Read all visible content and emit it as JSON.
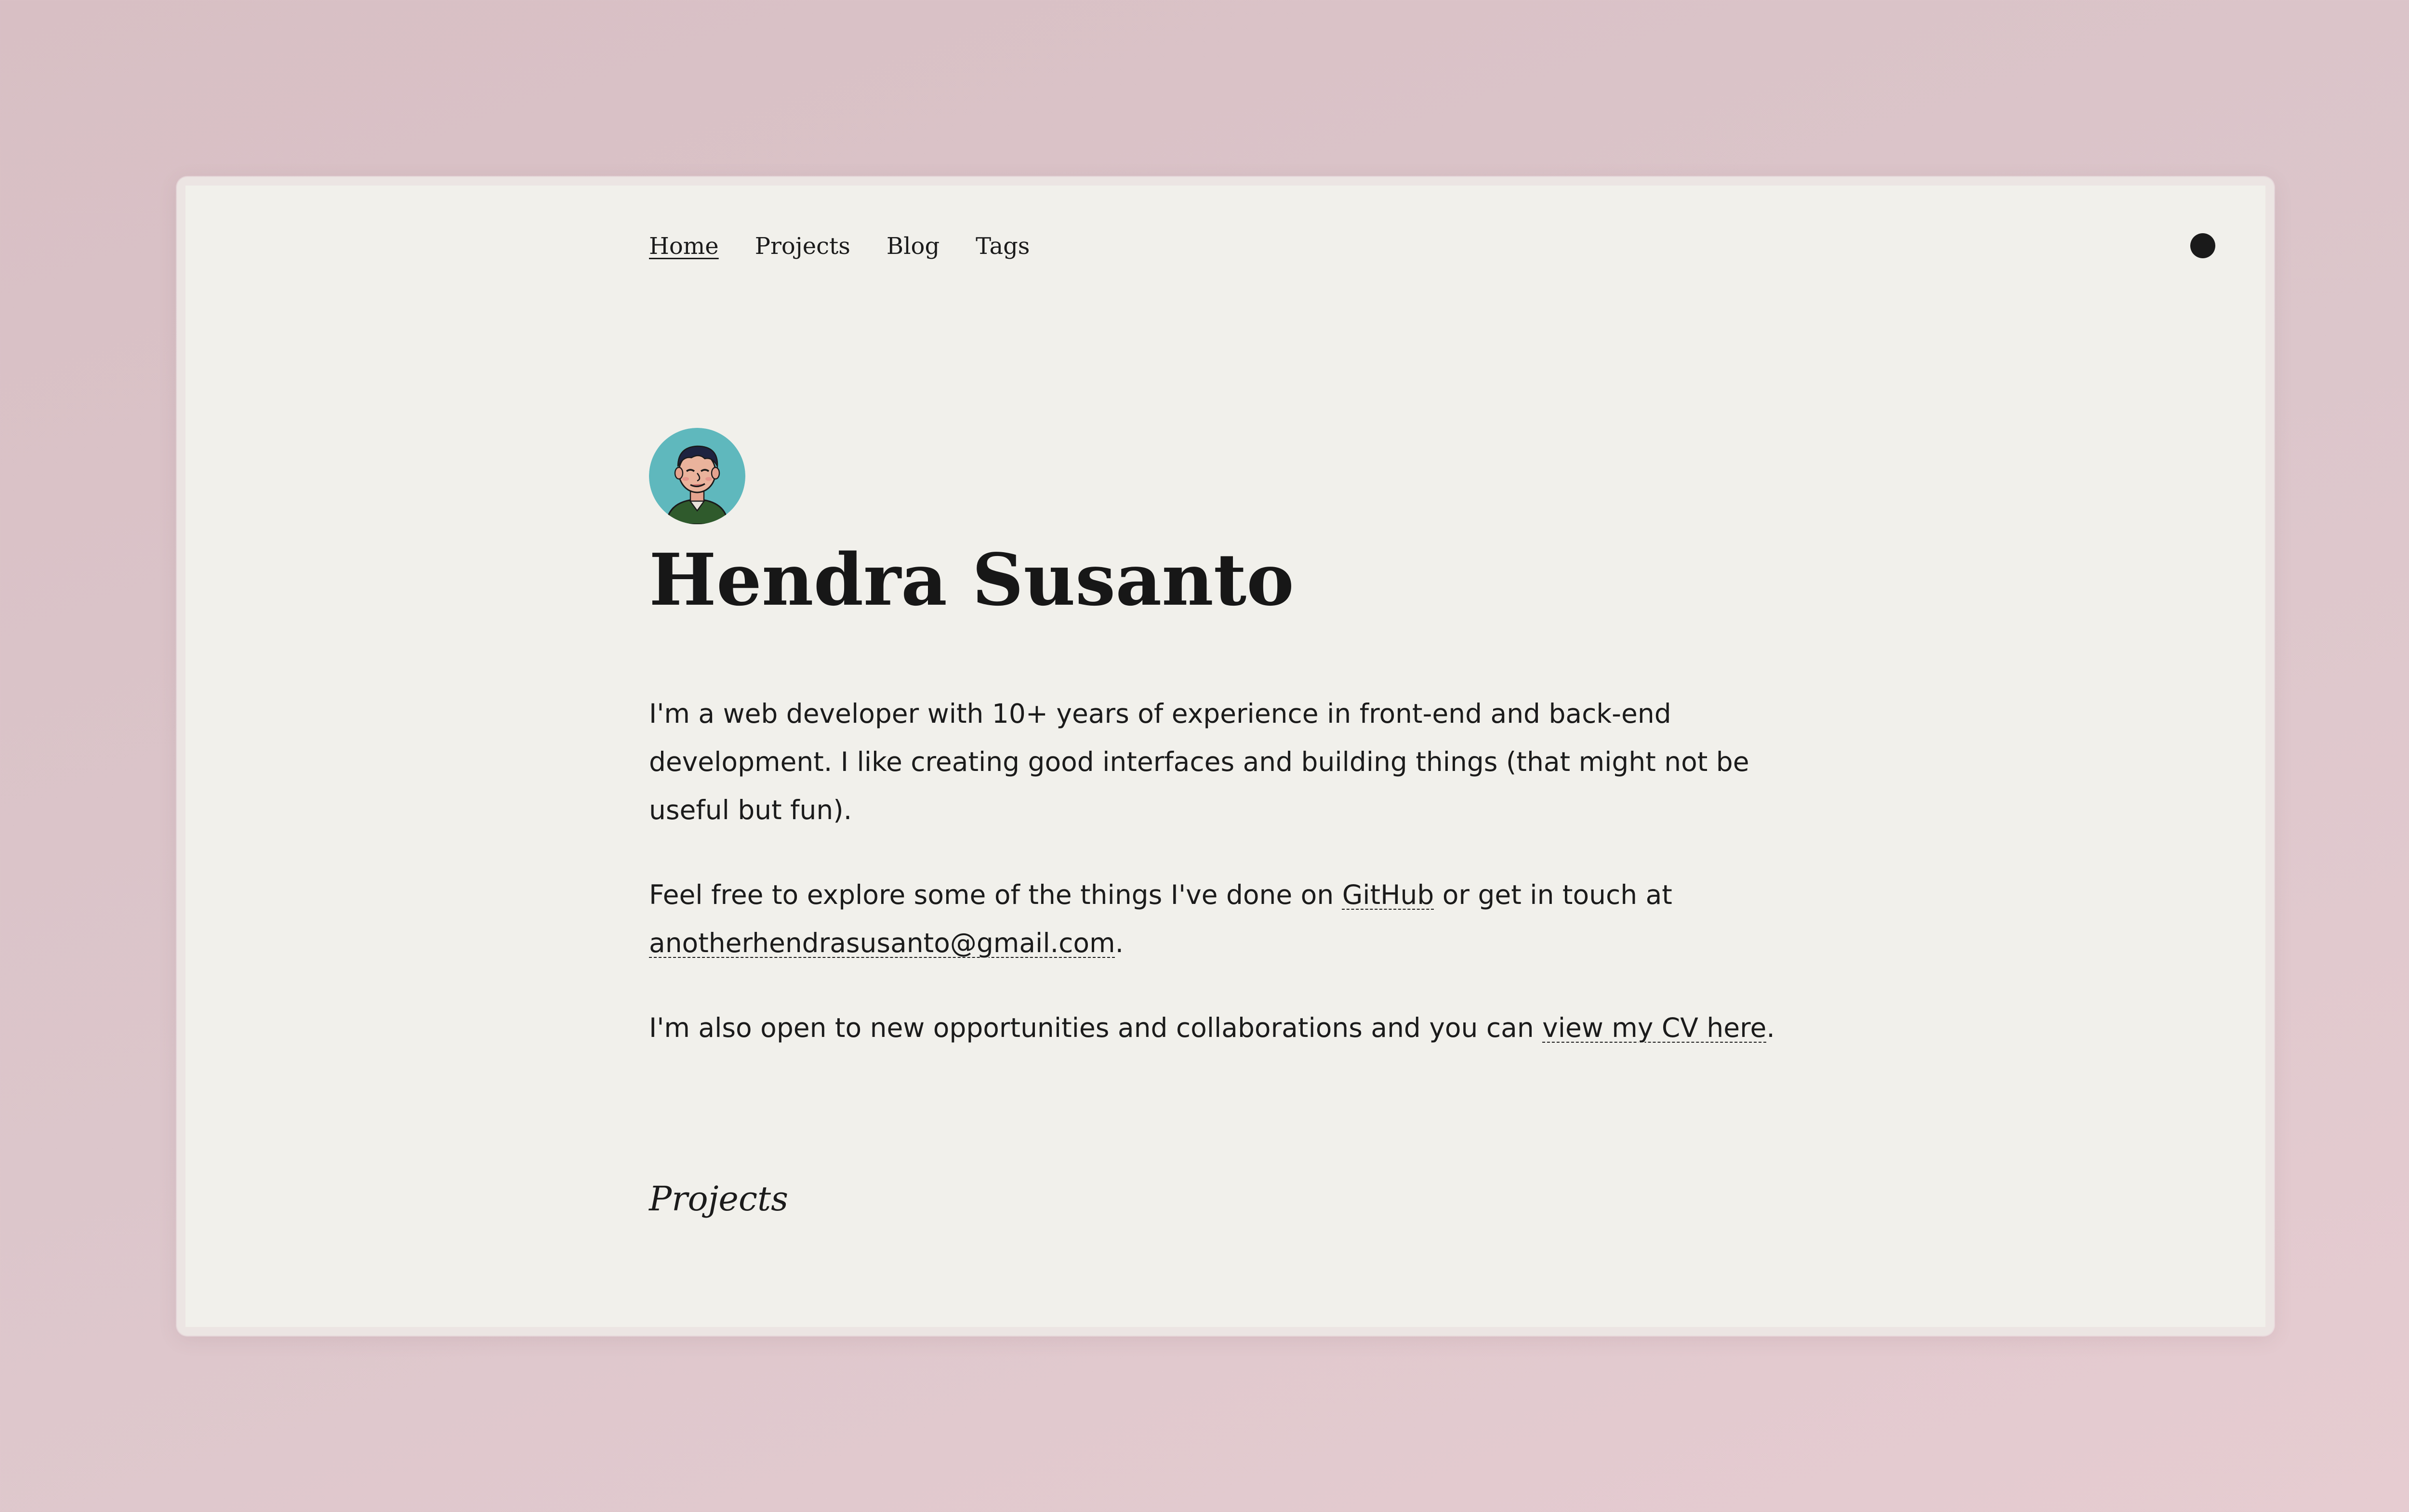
{
  "nav": {
    "items": [
      {
        "label": "Home",
        "active": true
      },
      {
        "label": "Projects",
        "active": false
      },
      {
        "label": "Blog",
        "active": false
      },
      {
        "label": "Tags",
        "active": false
      }
    ],
    "theme_toggle_icon": "circle-icon"
  },
  "profile": {
    "avatar_icon": "avatar-illustration",
    "name": "Hendra Susanto"
  },
  "bio": {
    "p1": "I'm a web developer with 10+ years of experience in front-end and back-end development. I like creating good interfaces and building things (that might not be useful but fun).",
    "p2_before": "Feel free to explore some of the things I've done on ",
    "p2_link1": "GitHub",
    "p2_middle": " or get in touch at ",
    "p2_link2": "anotherhendrasusanto@gmail.com",
    "p2_after": ".",
    "p3_before": "I'm also open to new opportunities and collaborations and you can ",
    "p3_link": "view my CV here",
    "p3_after": "."
  },
  "sections": {
    "projects_title": "Projects"
  },
  "colors": {
    "background": "#dcc3c8",
    "card": "#f1f0eb",
    "text": "#1b1b1b",
    "avatar_bg": "#5fb8bd"
  }
}
